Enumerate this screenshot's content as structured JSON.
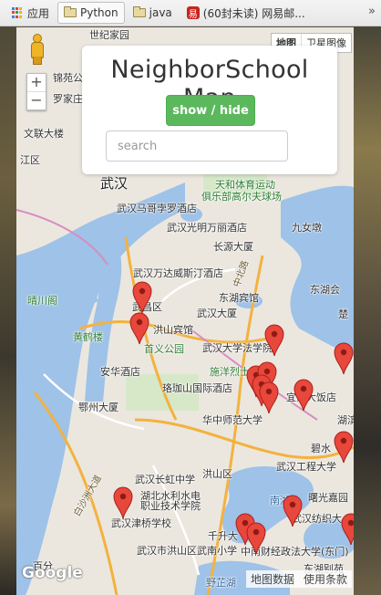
{
  "bookmarks": {
    "items": [
      {
        "label": "应用",
        "icon": "apps-grid-icon"
      },
      {
        "label": "Python",
        "icon": "folder-icon"
      },
      {
        "label": "java",
        "icon": "folder-icon"
      },
      {
        "label": "(60封未读) 网易邮...",
        "icon": "netease-mail-icon"
      }
    ],
    "overflow": "»"
  },
  "panel": {
    "title": "NeighborSchool Map",
    "toggle_label": "show / hide",
    "search_placeholder": "search",
    "search_value": ""
  },
  "map": {
    "zoom_in": "+",
    "zoom_out": "−",
    "map_type": [
      "地图",
      "卫星图像"
    ],
    "labels": [
      {
        "text": "世纪家园",
        "cls": ""
      },
      {
        "text": "锦苑公园",
        "cls": ""
      },
      {
        "text": "罗家庄",
        "cls": ""
      },
      {
        "text": "文联大楼",
        "cls": ""
      },
      {
        "text": "江区",
        "cls": ""
      },
      {
        "text": "武汉",
        "cls": "big"
      },
      {
        "text": "天和体育运动",
        "cls": "green"
      },
      {
        "text": "俱乐部高尔夫球场",
        "cls": "green"
      },
      {
        "text": "武汉马哥孛罗酒店",
        "cls": ""
      },
      {
        "text": "武汉光明万丽酒店",
        "cls": ""
      },
      {
        "text": "九女墩",
        "cls": ""
      },
      {
        "text": "长源大厦",
        "cls": ""
      },
      {
        "text": "武汉万达威斯汀酒店",
        "cls": ""
      },
      {
        "text": "晴川阁",
        "cls": "green"
      },
      {
        "text": "东湖宾馆",
        "cls": ""
      },
      {
        "text": "东湖会",
        "cls": ""
      },
      {
        "text": "武昌区",
        "cls": ""
      },
      {
        "text": "武汉大厦",
        "cls": ""
      },
      {
        "text": "洪山宾馆",
        "cls": ""
      },
      {
        "text": "黄鹤楼",
        "cls": "green"
      },
      {
        "text": "首义公园",
        "cls": "green"
      },
      {
        "text": "武汉大学法学院",
        "cls": ""
      },
      {
        "text": "安华酒店",
        "cls": ""
      },
      {
        "text": "施洋烈士",
        "cls": "green"
      },
      {
        "text": "珞珈山国际酒店",
        "cls": ""
      },
      {
        "text": "宜家大饭店",
        "cls": ""
      },
      {
        "text": "鄂州大厦",
        "cls": ""
      },
      {
        "text": "华中师范大学",
        "cls": ""
      },
      {
        "text": "湖滨",
        "cls": ""
      },
      {
        "text": "碧水",
        "cls": ""
      },
      {
        "text": "武汉工程大学",
        "cls": ""
      },
      {
        "text": "武汉长虹中学",
        "cls": ""
      },
      {
        "text": "洪山区",
        "cls": ""
      },
      {
        "text": "湖北水利水电",
        "cls": ""
      },
      {
        "text": "职业技术学院",
        "cls": ""
      },
      {
        "text": "曙光嘉园",
        "cls": ""
      },
      {
        "text": "武汉津桥学校",
        "cls": ""
      },
      {
        "text": "武汉纺织大",
        "cls": ""
      },
      {
        "text": "千升大",
        "cls": ""
      },
      {
        "text": "武汉市洪山区武南小学",
        "cls": ""
      },
      {
        "text": "中南财经政法大学(东门)",
        "cls": ""
      },
      {
        "text": "东湖别苑",
        "cls": ""
      },
      {
        "text": "野芷湖",
        "cls": "blue"
      },
      {
        "text": "南湖",
        "cls": "blue"
      },
      {
        "text": "白沙洲大道",
        "cls": "road"
      },
      {
        "text": "中北路",
        "cls": "road"
      },
      {
        "text": "楚",
        "cls": ""
      },
      {
        "text": "百分",
        "cls": ""
      }
    ],
    "attribution": {
      "logo": "Google",
      "map_data": "地图数据",
      "terms": "使用条款"
    }
  }
}
